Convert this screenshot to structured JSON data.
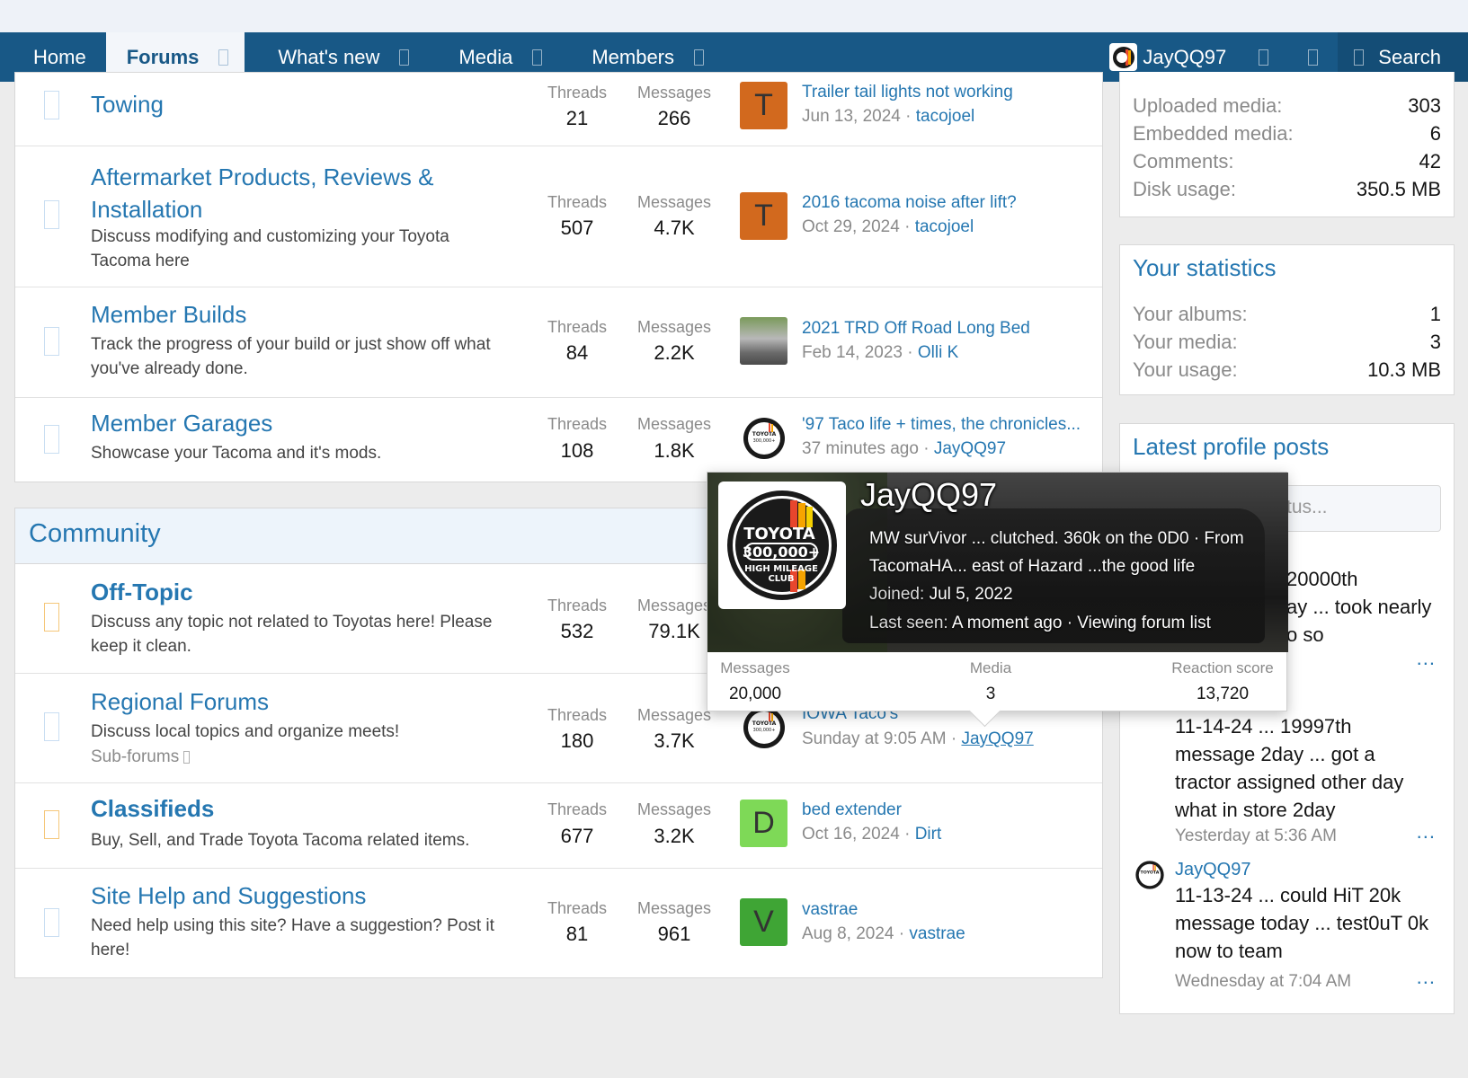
{
  "nav": {
    "tabs": [
      "Home",
      "Forums",
      "What's new",
      "Media",
      "Members"
    ],
    "user": "JayQQ97",
    "search": "Search"
  },
  "forums": [
    {
      "title": "Towing",
      "desc": "",
      "threads_label": "Threads",
      "threads": "21",
      "messages_label": "Messages",
      "messages": "266",
      "last_title": "Trailer tail lights not working",
      "last_date": "Jun 13, 2024",
      "last_user": "tacojoel",
      "avatar_letter": "T",
      "avatar_color": "#d2691e"
    },
    {
      "title": "Aftermarket Products, Reviews &",
      "title2": "Installation",
      "desc": "Discuss modifying and customizing your Toyota Tacoma here",
      "threads_label": "Threads",
      "threads": "507",
      "messages_label": "Messages",
      "messages": "4.7K",
      "last_title": "2016 tacoma noise after lift?",
      "last_date": "Oct 29, 2024",
      "last_user": "tacojoel",
      "avatar_letter": "T",
      "avatar_color": "#d2691e"
    },
    {
      "title": "Member Builds",
      "desc": "Track the progress of your build or just show off what you've already done.",
      "threads_label": "Threads",
      "threads": "84",
      "messages_label": "Messages",
      "messages": "2.2K",
      "last_title": "2021 TRD Off Road Long Bed",
      "last_date": "Feb 14, 2023",
      "last_user": "Olli K"
    },
    {
      "title": "Member Garages",
      "desc": "Showcase your Tacoma and it's mods.",
      "threads_label": "Threads",
      "threads": "108",
      "messages_label": "Messages",
      "messages": "1.8K",
      "last_title": "'97 Taco life + times, the chronicles...",
      "last_date": "37 minutes ago",
      "last_user": "JayQQ97"
    }
  ],
  "community": {
    "heading": "Community",
    "forums": [
      {
        "title": "Off-Topic",
        "desc": "Discuss any topic not related to Toyotas here! Please keep it clean.",
        "threads_label": "Threads",
        "threads": "532",
        "messages_label": "Messages",
        "messages": "79.1K"
      },
      {
        "title": "Regional Forums",
        "desc": "Discuss local topics and organize meets!",
        "sub": "Sub-forums",
        "threads_label": "Threads",
        "threads": "180",
        "messages_label": "Messages",
        "messages": "3.7K",
        "last_title": "IOWA Taco's",
        "last_date": "Sunday at 9:05 AM",
        "last_user": "JayQQ97"
      },
      {
        "title": "Classifieds",
        "desc": "Buy, Sell, and Trade Toyota Tacoma related items.",
        "threads_label": "Threads",
        "threads": "677",
        "messages_label": "Messages",
        "messages": "3.2K",
        "last_title": "bed extender",
        "last_date": "Oct 16, 2024",
        "last_user": "Dirt",
        "avatar_letter": "D",
        "avatar_color": "#7ed957"
      },
      {
        "title": "Site Help and Suggestions",
        "desc": "Need help using this site? Have a suggestion? Post it here!",
        "threads_label": "Threads",
        "threads": "81",
        "messages_label": "Messages",
        "messages": "961",
        "last_title": "vastrae",
        "last_date": "Aug 8, 2024",
        "last_user": "vastrae",
        "avatar_letter": "V",
        "avatar_color": "#3fa535"
      }
    ]
  },
  "media_stats": {
    "rows": [
      {
        "k": "Uploaded media:",
        "v": "303"
      },
      {
        "k": "Embedded media:",
        "v": "6"
      },
      {
        "k": "Comments:",
        "v": "42"
      },
      {
        "k": "Disk usage:",
        "v": "350.5 MB"
      }
    ]
  },
  "your_stats": {
    "title": "Your statistics",
    "rows": [
      {
        "k": "Your albums:",
        "v": "1"
      },
      {
        "k": "Your media:",
        "v": "3"
      },
      {
        "k": "Your usage:",
        "v": "10.3 MB"
      }
    ]
  },
  "profile_posts": {
    "title": "Latest profile posts",
    "placeholder": "tus...",
    "p1_lines": [
      "20000th",
      "ay ... took nearly",
      "o so"
    ],
    "p2_text": "11-14-24 ... 19997th message 2day ... got a tractor assigned other day what in store 2day",
    "p2_meta": "Yesterday at 5:36 AM",
    "p3_user": "JayQQ97",
    "p3_text": "11-13-24 ... could HiT 20k message today ... test0uT 0k now to team",
    "p3_meta": "Wednesday at 7:04 AM",
    "more": "..."
  },
  "tooltip": {
    "name": "JayQQ97",
    "bio": "MW surVivor ... clutched. 360k on the 0D0 · From",
    "bio2": "TacomaHA... east of Hazard ...the good life",
    "joined_label": "Joined:",
    "joined": "Jul 5, 2022",
    "seen_label": "Last seen:",
    "seen": "A moment ago · Viewing forum list",
    "stats": [
      {
        "label": "Messages",
        "value": "20,000"
      },
      {
        "label": "Media",
        "value": "3"
      },
      {
        "label": "Reaction score",
        "value": "13,720"
      }
    ],
    "badge": [
      "TOYOTA",
      "300,000+",
      "HIGH MILEAGE",
      "CLUB"
    ]
  }
}
